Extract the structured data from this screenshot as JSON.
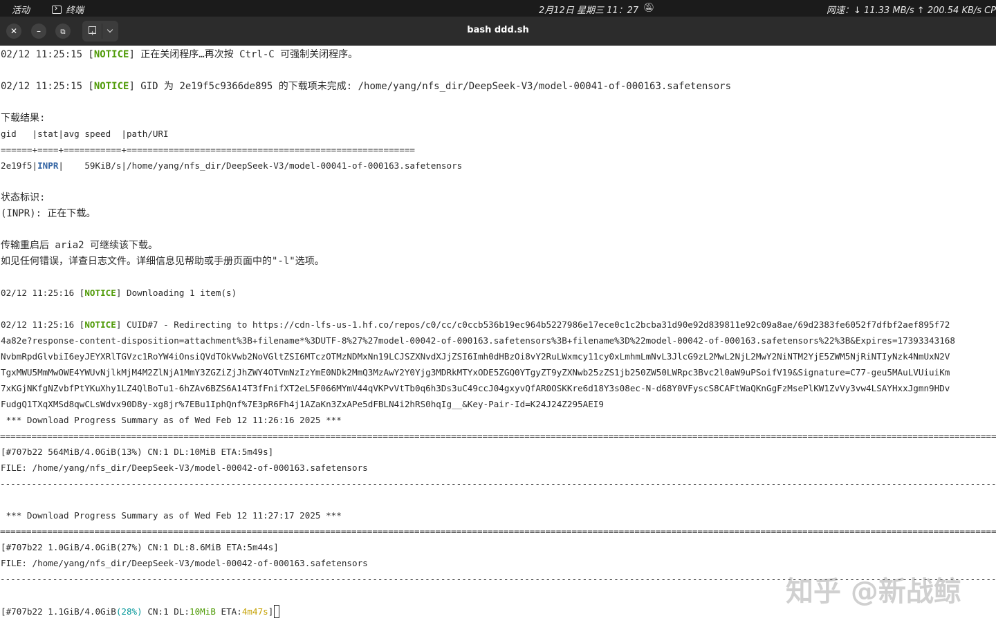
{
  "topbar": {
    "activities": "活动",
    "app_name": "终端",
    "datetime": "2月12日 星期三 11：27",
    "bell_icon": "bell-off-icon",
    "network": "网速：↓ 11.33 MB/s ↑ 200.54 KB/s CPU"
  },
  "window": {
    "title": "bash ddd.sh",
    "close_icon": "close-icon",
    "minimize_icon": "minimize-icon",
    "restore_icon": "restore-icon",
    "new_tab_icon": "new-tab-icon",
    "menu_icon": "chevron-down-icon"
  },
  "colors": {
    "notice": "#4e9a06",
    "inpr": "#3465a4",
    "percent": "#06989a",
    "speed": "#4e9a06",
    "eta": "#c4a000"
  },
  "terminal": {
    "l1_pre": "02/12 11:25:15 [",
    "l1_tag": "NOTICE",
    "l1_post": "] 正在关闭程序…再次按 Ctrl-C 可强制关闭程序。",
    "l2_pre": "02/12 11:25:15 [",
    "l2_tag": "NOTICE",
    "l2_post": "] GID 为 2e19f5c9366de895 的下载项未完成: /home/yang/nfs_dir/DeepSeek-V3/model-00041-of-000163.safetensors",
    "result_title": "下载结果:",
    "table_header": "gid   |stat|avg speed  |path/URI",
    "table_sep": "======+====+===========+=======================================================",
    "row_gid": "2e19f5|",
    "row_stat": "INPR",
    "row_rest": "|    59KiB/s|/home/yang/nfs_dir/DeepSeek-V3/model-00041-of-000163.safetensors",
    "status_title": "状态标识:",
    "status_inpr": "(INPR): 正在下载。",
    "resume_hint": "传输重启后 aria2 可继续该下载。",
    "error_hint": "如见任何错误，详查日志文件。详细信息见帮助或手册页面中的\"-l\"选项。",
    "l3_pre": "02/12 11:25:16 [",
    "l3_tag": "NOTICE",
    "l3_post": "] Downloading 1 item(s)",
    "l4_pre": "02/12 11:25:16 [",
    "l4_tag": "NOTICE",
    "l4_post": "] CUID#7 - Redirecting to https://cdn-lfs-us-1.hf.co/repos/c0/cc/c0ccb536b19ec964b5227986e17ece0c1c2bcba31d90e92d839811e92c09a8ae/69d2383fe6052f7dfbf2aef895f72",
    "url2": "4a82e?response-content-disposition=attachment%3B+filename*%3DUTF-8%27%27model-00042-of-000163.safetensors%3B+filename%3D%22model-00042-of-000163.safetensors%22%3B&Expires=17393343168",
    "url3": "NvbmRpdGlvbiI6eyJEYXRlTGVzc1RoYW4iOnsiQVdTOkVwb2NoVGltZSI6MTczOTMzNDMxNn19LCJSZXNvdXJjZSI6Imh0dHBzOi8vY2RuLWxmcy11cy0xLmhmLmNvL3JlcG9zL2MwL2NjL2MwY2NiNTM2YjE5ZWM5NjRiNTIyNzk4NmUxN2V",
    "url4": "TgxMWU5MmMwOWE4YWUvNjlkMjM4M2ZlNjA1MmY3ZGZiZjJhZWY4OTVmNzIzYmE0NDk2MmQ3MzAwY2Y0Yjg3MDRkMTYxODE5ZGQ0YTgyZT9yZXNwb25zZS1jb250ZW50LWRpc3Bvc2l0aW9uPSoifV19&Signature=C77-geu5MAuLVUiuiKm",
    "url5": "7xKGjNKfgNZvbfPtYKuXhy1LZ4QlBoTu1-6hZAv6BZS6A14T3fFnifXT2eL5F066MYmV44qVKPvVtTb0q6h3Ds3uC49ccJ04gxyvQfAR0OSKKre6d18Y3s08ec-N-d68Y0VFyscS8CAFtWaQKnGgFzMsePlKW1ZvVy3vw4LSAYHxxJgmn9HDv",
    "url6": "FudgQ1TXqXMSd8qwCLsWdvx90D8y-xg8jr%7EBu1IphQnf%7E3pR6Fh4j1AZaKn3ZxAPe5dFBLN4i2hRS0hqIg__&Key-Pair-Id=K24J24Z295AEI9",
    "summary1": " *** Download Progress Summary as of Wed Feb 12 11:26:16 2025 ***",
    "progress1": "[#707b22 564MiB/4.0GiB(13%) CN:1 DL:10MiB ETA:5m49s]",
    "file1": "FILE: /home/yang/nfs_dir/DeepSeek-V3/model-00042-of-000163.safetensors",
    "summary2": " *** Download Progress Summary as of Wed Feb 12 11:27:17 2025 ***",
    "progress2": "[#707b22 1.0GiB/4.0GiB(27%) CN:1 DL:8.6MiB ETA:5m44s]",
    "file2": "FILE: /home/yang/nfs_dir/DeepSeek-V3/model-00042-of-000163.safetensors",
    "live_a": "[#707b22 1.1GiB/4.0GiB",
    "live_pct": "(28%)",
    "live_b": " CN:1 DL:",
    "live_dl": "10MiB",
    "live_c": " ETA:",
    "live_eta": "4m47s",
    "live_d": "]"
  },
  "watermark": "知乎 @新战鲸"
}
